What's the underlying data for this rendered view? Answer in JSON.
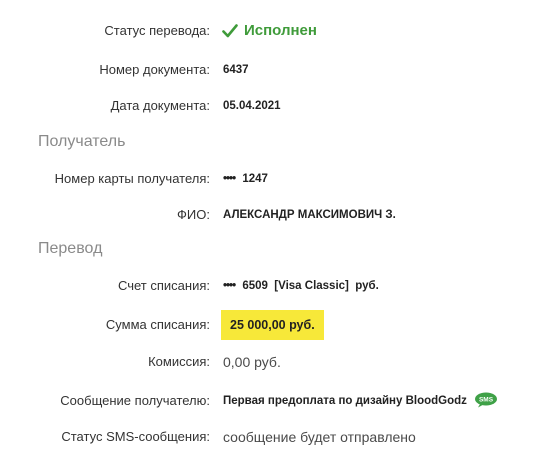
{
  "status": {
    "label": "Статус перевода:",
    "value": "Исполнен",
    "icon": "checkmark-icon",
    "color": "#3f9b3a"
  },
  "doc_number": {
    "label": "Номер документа:",
    "value": "6437"
  },
  "doc_date": {
    "label": "Дата документа:",
    "value": "05.04.2021"
  },
  "recipient": {
    "section_title": "Получатель",
    "card_label": "Номер карты получателя:",
    "card_dots": "••••",
    "card_last4": "1247",
    "name_label": "ФИО:",
    "name_value": "АЛЕКСАНДР МАКСИМОВИЧ З."
  },
  "transfer": {
    "section_title": "Перевод",
    "account_label": "Счет списания:",
    "account_dots": "••••",
    "account_last4": "6509",
    "account_type": "[Visa Classic]",
    "account_currency": "руб.",
    "amount_label": "Сумма списания:",
    "amount_value": "25 000,00  руб.",
    "amount_highlight_color": "#f7e839",
    "fee_label": "Комиссия:",
    "fee_value": "0,00 руб.",
    "message_label": "Сообщение получателю:",
    "message_value": "Первая предоплата по дизайну BloodGodz",
    "message_badge": "SMS",
    "sms_status_label": "Статус SMS-сообщения:",
    "sms_status_value": "сообщение будет отправлено"
  }
}
